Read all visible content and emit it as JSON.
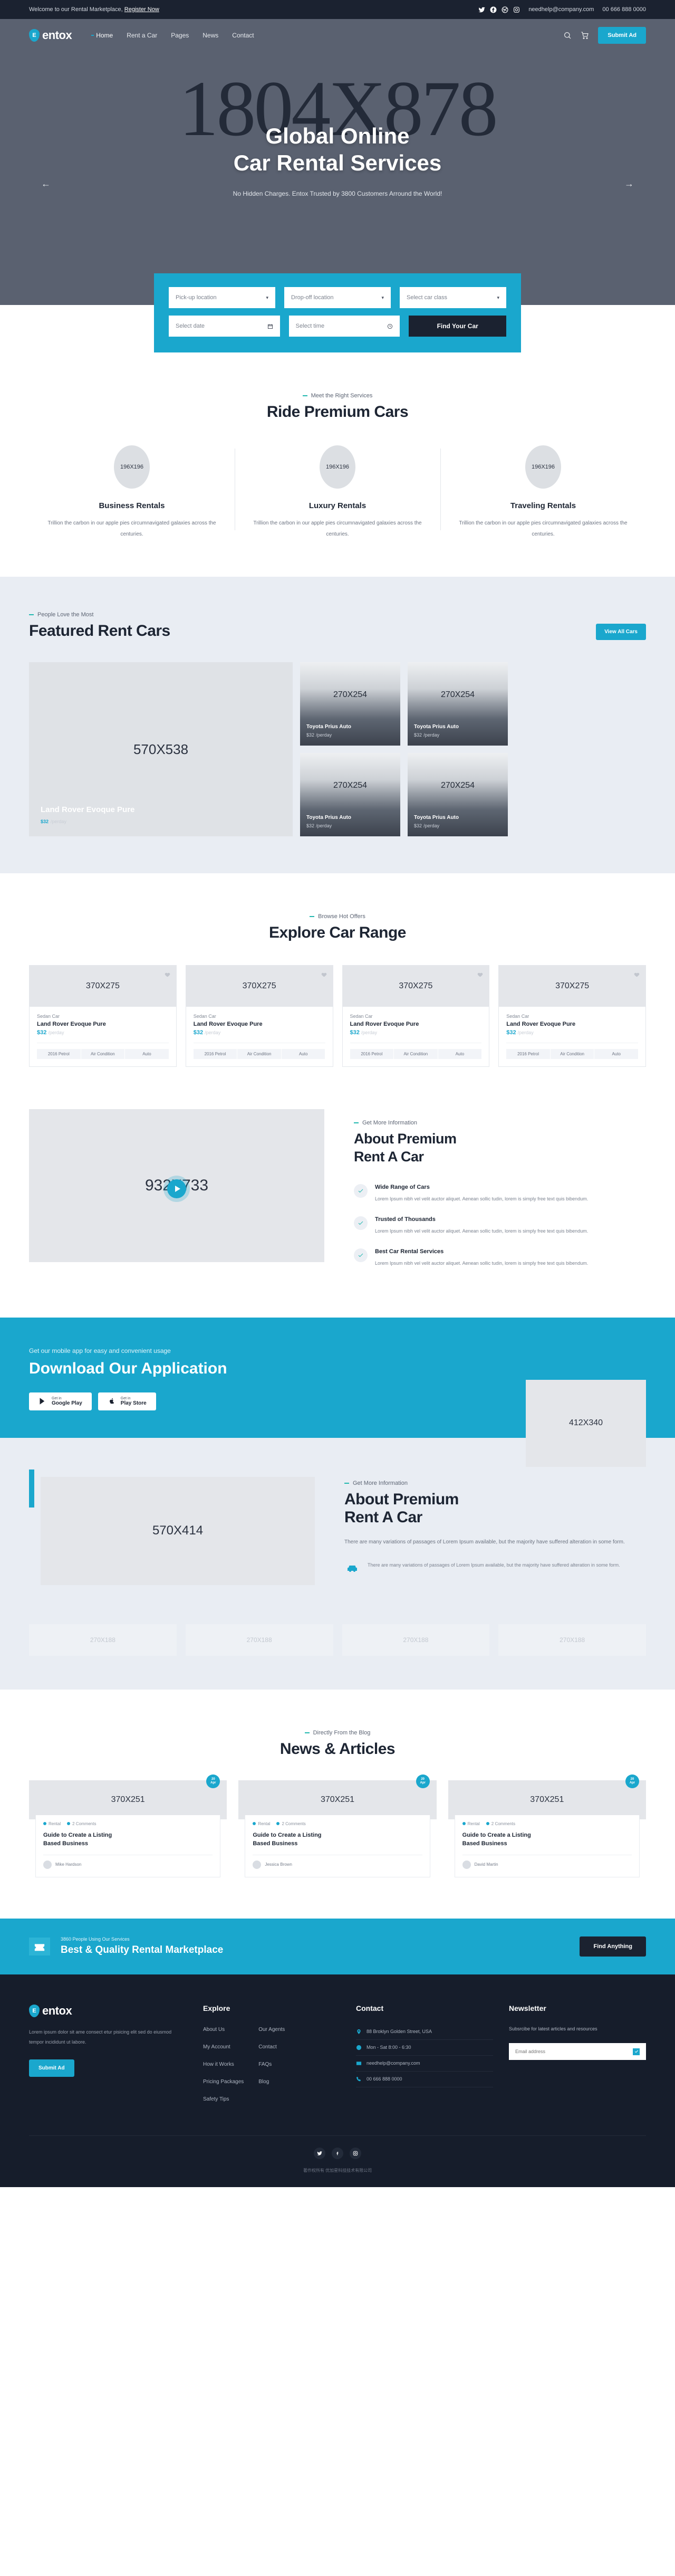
{
  "topbar": {
    "welcome": "Welcome to our Rental Marketplace,",
    "register": "Register Now",
    "email": "needhelp@company.com",
    "phone": "00 666 888 0000",
    "socials": [
      "twitter-icon",
      "facebook-icon",
      "dribbble-icon",
      "instagram-icon"
    ]
  },
  "header": {
    "logo_mark": "E",
    "logo_text": "entox",
    "nav": [
      {
        "label": "Home",
        "active": true
      },
      {
        "label": "Rent a Car",
        "active": false
      },
      {
        "label": "Pages",
        "active": false
      },
      {
        "label": "News",
        "active": false
      },
      {
        "label": "Contact",
        "active": false
      }
    ],
    "submit_ad": "Submit Ad"
  },
  "hero": {
    "placeholder": "1804X878",
    "title_line1": "Global Online",
    "title_line2": "Car Rental Services",
    "subtitle": "No Hidden Charges. Entox Trusted by 3800 Customers Arround the World!",
    "prev": "←",
    "next": "→"
  },
  "searchform": {
    "pickup": "Pick-up location",
    "dropoff": "Drop-off location",
    "carclass": "Select car class",
    "date": "Select date",
    "time": "Select time",
    "submit": "Find Your Car"
  },
  "services": {
    "eyebrow": "Meet the Right Services",
    "title": "Ride Premium Cars",
    "items": [
      {
        "ph": "196X196",
        "title": "Business Rentals",
        "desc": "Trillion the carbon in our apple pies circumnavigated galaxies across the centuries."
      },
      {
        "ph": "196X196",
        "title": "Luxury Rentals",
        "desc": "Trillion the carbon in our apple pies circumnavigated galaxies across the centuries."
      },
      {
        "ph": "196X196",
        "title": "Traveling Rentals",
        "desc": "Trillion the carbon in our apple pies circumnavigated galaxies across the centuries."
      }
    ]
  },
  "featured": {
    "eyebrow": "People Love the Most",
    "title": "Featured Rent Cars",
    "view_all": "View All Cars",
    "big": {
      "ph": "570X538",
      "title": "Land Rover Evoque Pure",
      "price": "$32",
      "unit": "/perday"
    },
    "small": [
      {
        "ph": "270X254",
        "title": "Toyota Prius Auto",
        "price": "$32",
        "unit": "/perday"
      },
      {
        "ph": "270X254",
        "title": "Toyota Prius Auto",
        "price": "$32",
        "unit": "/perday"
      },
      {
        "ph": "270X254",
        "title": "Toyota Prius Auto",
        "price": "$32",
        "unit": "/perday"
      },
      {
        "ph": "270X254",
        "title": "Toyota Prius Auto",
        "price": "$32",
        "unit": "/perday"
      }
    ]
  },
  "explore": {
    "eyebrow": "Browse Hot Offers",
    "title": "Explore Car Range",
    "cards": [
      {
        "ph": "370X275",
        "cat": "Sedan Car",
        "title": "Land Rover Evoque Pure",
        "price": "$32",
        "unit": "/perday",
        "tags": [
          "2016 Petrol",
          "Air Condition",
          "Auto"
        ]
      },
      {
        "ph": "370X275",
        "cat": "Sedan Car",
        "title": "Land Rover Evoque Pure",
        "price": "$32",
        "unit": "/perday",
        "tags": [
          "2016 Petrol",
          "Air Condition",
          "Auto"
        ]
      },
      {
        "ph": "370X275",
        "cat": "Sedan Car",
        "title": "Land Rover Evoque Pure",
        "price": "$32",
        "unit": "/perday",
        "tags": [
          "2016 Petrol",
          "Air Condition",
          "Auto"
        ]
      },
      {
        "ph": "370X275",
        "cat": "Sedan Car",
        "title": "Land Rover Evoque Pure",
        "price": "$32",
        "unit": "/perday",
        "tags": [
          "2016 Petrol",
          "Air Condition",
          "Auto"
        ]
      }
    ]
  },
  "about": {
    "media_ph": "932X733",
    "eyebrow": "Get More Information",
    "title_line1": "About Premium",
    "title_line2": "Rent A Car",
    "features": [
      {
        "title": "Wide Range of Cars",
        "desc": "Lorem Ipsum nibh vel velit auctor aliquet. Aenean sollic tudin, lorem is simply free text quis bibendum."
      },
      {
        "title": "Trusted of Thousands",
        "desc": "Lorem Ipsum nibh vel velit auctor aliquet. Aenean sollic tudin, lorem is simply free text quis bibendum."
      },
      {
        "title": "Best Car Rental Services",
        "desc": "Lorem Ipsum nibh vel velit auctor aliquet. Aenean sollic tudin, lorem is simply free text quis bibendum."
      }
    ]
  },
  "app": {
    "sub": "Get our mobile app for easy and convenient usage",
    "title": "Download Our Application",
    "stores": [
      {
        "small": "Get in",
        "big": "Google Play",
        "icon": "google-play-icon"
      },
      {
        "small": "Get in",
        "big": "Play Store",
        "icon": "apple-icon"
      }
    ],
    "image_ph": "412X340"
  },
  "about2": {
    "media_ph": "570X414",
    "eyebrow": "Get More Information",
    "title_line1": "About Premium",
    "title_line2": "Rent A Car",
    "lead": "There are many variations of passages of Lorem Ipsum available, but the majority have suffered alteration in some form.",
    "item_desc": "There are many variations of passages of Lorem Ipsum available, but the majority have suffered alteration in some form."
  },
  "brandlogos": [
    "270X188",
    "270X188",
    "270X188",
    "270X188"
  ],
  "news": {
    "eyebrow": "Directly From the Blog",
    "title": "News & Articles",
    "posts": [
      {
        "ph": "370X251",
        "day": "20",
        "month": "Apr",
        "cat": "Rental",
        "comments": "2 Comments",
        "title_line1": "Guide to Create a Listing",
        "title_line2": "Based Business",
        "author": "Mike Hardson"
      },
      {
        "ph": "370X251",
        "day": "20",
        "month": "Apr",
        "cat": "Rental",
        "comments": "2 Comments",
        "title_line1": "Guide to Create a Listing",
        "title_line2": "Based Business",
        "author": "Jessica Brown"
      },
      {
        "ph": "370X251",
        "day": "20",
        "month": "Apr",
        "cat": "Rental",
        "comments": "2 Comments",
        "title_line1": "Guide to Create a Listing",
        "title_line2": "Based Business",
        "author": "David Martin"
      }
    ]
  },
  "cta": {
    "sub": "3860 People Using Our Services",
    "title": "Best & Quality Rental Marketplace",
    "button": "Find Anything"
  },
  "footer": {
    "logo_mark": "E",
    "logo_text": "entox",
    "about": "Lorem ipsum dolor sit ame consect etur pisicing elit sed do eiusmod tempor incididunt ut labore.",
    "submit_ad": "Submit Ad",
    "explore_title": "Explore",
    "explore_col1": [
      "About Us",
      "My Account",
      "How it Works",
      "Pricing Packages",
      "Safety Tips"
    ],
    "explore_col2": [
      "Our Agents",
      "Contact",
      "FAQs",
      "Blog"
    ],
    "contact_title": "Contact",
    "contact": [
      {
        "icon": "location-icon",
        "text": "88 Broklyn Golden Street, USA"
      },
      {
        "icon": "clock-icon",
        "text": "Mon - Sat 8:00 - 6:30"
      },
      {
        "icon": "mail-icon",
        "text": "needhelp@company.com"
      },
      {
        "icon": "phone-icon",
        "text": "00 666 888 0000"
      }
    ],
    "newsletter_title": "Newsletter",
    "newsletter_desc": "Subsrcibe for latest articles and resources",
    "email_placeholder": "Email address",
    "socials": [
      "twitter-icon",
      "facebook-icon",
      "instagram-icon"
    ],
    "copyright": "著作权所有 优加星科技技术有限公司"
  },
  "colors": {
    "accent": "#1aa7cd",
    "dark": "#1b2230",
    "teal": "#23b8b0"
  }
}
